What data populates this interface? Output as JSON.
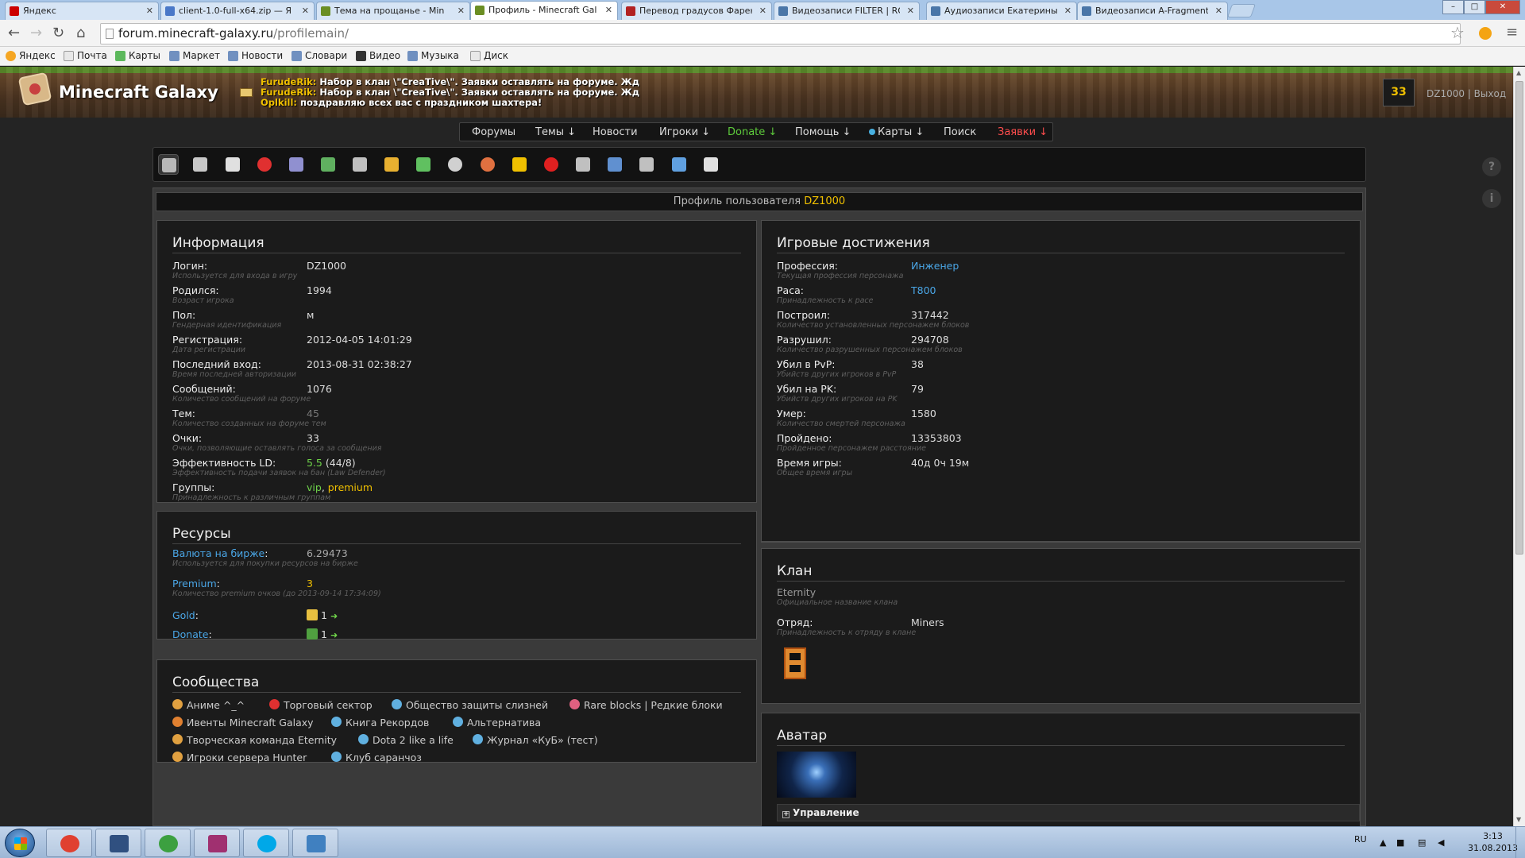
{
  "browser": {
    "tabs": [
      {
        "label": "Яндекс",
        "color": "#cc0000"
      },
      {
        "label": "client-1.0-full-x64.zip — Я",
        "color": "#4a78c8"
      },
      {
        "label": "Тема на прощанье - Min",
        "color": "#6b8e23"
      },
      {
        "label": "Профиль - Minecraft Gal",
        "color": "#6b8e23"
      },
      {
        "label": "Перевод градусов Фарен",
        "color": "#b22222"
      },
      {
        "label": "Видеозаписи FILTER | RO",
        "color": "#4a76a8"
      },
      {
        "label": "Аудиозаписи Екатерины",
        "color": "#4a76a8"
      },
      {
        "label": "Видеозаписи A-Fragment",
        "color": "#4a76a8"
      }
    ],
    "url_host": "forum.minecraft-galaxy.ru",
    "url_path": "/profilemain/",
    "window_min": "–",
    "window_max": "□",
    "window_close": "✕",
    "bookmarks": [
      {
        "label": "Яндекс",
        "icon": "yandex-icon",
        "color": "#f5a623"
      },
      {
        "label": "Почта",
        "icon": "page-icon",
        "color": "#e8e8e8"
      },
      {
        "label": "Карты",
        "icon": "maps-icon",
        "color": "#5cb85c"
      },
      {
        "label": "Маркет",
        "icon": "market-icon",
        "color": "#7090c0"
      },
      {
        "label": "Новости",
        "icon": "news-icon",
        "color": "#7090c0"
      },
      {
        "label": "Словари",
        "icon": "dict-icon",
        "color": "#7090c0"
      },
      {
        "label": "Видео",
        "icon": "video-icon",
        "color": "#333333"
      },
      {
        "label": "Музыка",
        "icon": "music-icon",
        "color": "#7090c0"
      },
      {
        "label": "Диск",
        "icon": "page-icon",
        "color": "#e8e8e8"
      }
    ]
  },
  "site": {
    "logo": "Minecraft Galaxy",
    "news": [
      {
        "who": "FurudeRik:",
        "text": " Набор в клан \\\"CreaTive\\\". Заявки оставлять на форуме. Жд"
      },
      {
        "who": "FurudeRik:",
        "text": " Набор в клан \\\"CreaTive\\\". Заявки оставлять на форуме. Жд"
      },
      {
        "who": "Oplkill:",
        "text": " поздравляю всех вас с праздником шахтера!"
      }
    ],
    "user_badge": "33",
    "user_name": "DZ1000",
    "user_sep": " | ",
    "logout": "Выход",
    "menu": [
      {
        "label": "Форумы",
        "style": ""
      },
      {
        "label": "Темы ↓",
        "style": ""
      },
      {
        "label": "Новости",
        "style": ""
      },
      {
        "label": "Игроки ↓",
        "style": ""
      },
      {
        "label": "Donate ↓",
        "style": "green"
      },
      {
        "label": "Помощь ↓",
        "style": ""
      },
      {
        "label": "Карты ↓",
        "style": "dot"
      },
      {
        "label": "Поиск",
        "style": ""
      },
      {
        "label": "Заявки ↓",
        "style": "red"
      }
    ],
    "icon_bar": [
      {
        "name": "profile-icon",
        "color": "#b8b8b8"
      },
      {
        "name": "lock-icon",
        "color": "#c8c8c8"
      },
      {
        "name": "home-icon",
        "color": "#e0e0e0"
      },
      {
        "name": "ban-icon",
        "color": "#e03030"
      },
      {
        "name": "window-icon",
        "color": "#9090d0"
      },
      {
        "name": "screenshot-icon",
        "color": "#60b060"
      },
      {
        "name": "cart-icon",
        "color": "#c0c0c0"
      },
      {
        "name": "medal-icon",
        "color": "#e8b030"
      },
      {
        "name": "user-icon",
        "color": "#60c060"
      },
      {
        "name": "gear-icon",
        "color": "#d0d0d0"
      },
      {
        "name": "alarm-icon",
        "color": "#e07040"
      },
      {
        "name": "star-icon",
        "color": "#f0c000"
      },
      {
        "name": "heart-icon",
        "color": "#e02020"
      },
      {
        "name": "chart-icon",
        "color": "#c0c0c0"
      },
      {
        "name": "mail-icon",
        "color": "#6090d0"
      },
      {
        "name": "notes-icon",
        "color": "#c0c0c0"
      },
      {
        "name": "folder-icon",
        "color": "#60a0e0"
      },
      {
        "name": "document-icon",
        "color": "#e0e0e0"
      }
    ],
    "side_help": "?",
    "side_info": "i"
  },
  "profile": {
    "title_prefix": "Профиль пользователя",
    "nick": "DZ1000",
    "info": {
      "heading": "Информация",
      "rows": [
        {
          "label": "Логин:",
          "sub": "Используется для входа в игру",
          "value": "DZ1000"
        },
        {
          "label": "Родился:",
          "sub": "Возраст игрока",
          "value": "1994"
        },
        {
          "label": "Пол:",
          "sub": "Гендерная идентификация",
          "value": "м"
        },
        {
          "label": "Регистрация:",
          "sub": "Дата регистрации",
          "value": "2012-04-05 14:01:29"
        },
        {
          "label": "Последний вход:",
          "sub": "Время последней авторизации",
          "value": "2013-08-31 02:38:27"
        },
        {
          "label": "Сообщений:",
          "sub": "Количество сообщений на форуме",
          "value": "1076"
        },
        {
          "label": "Тем:",
          "sub": "Количество созданных на форуме тем",
          "value": "45"
        },
        {
          "label": "Очки:",
          "sub": "Очки, позволяющие оставлять голоса за сообщения",
          "value": "33"
        },
        {
          "label": "Эффективность LD:",
          "sub": "Эффективность подачи заявок на бан (Law Defender)",
          "value_a": "5.5",
          "value_b": " (44/8)"
        },
        {
          "label": "Группы:",
          "sub": "Принадлежность к различным группам",
          "value_a": "vip",
          "value_sep": ", ",
          "value_b": "premium"
        }
      ]
    },
    "resources": {
      "heading": "Ресурсы",
      "rows": [
        {
          "label": "Валюта на бирже",
          "colon": ":",
          "sub": "Используется для покупки ресурсов на бирже",
          "value": "6.29473"
        },
        {
          "label": "Premium",
          "colon": ":",
          "sub": "Количество premium очков (до 2013-09-14 17:34:09)",
          "value": "3"
        },
        {
          "label": "Gold",
          "colon": ":",
          "value": "1",
          "arrow": "➜"
        },
        {
          "label": "Donate",
          "colon": ":",
          "value": "1",
          "arrow": "➜"
        }
      ]
    },
    "communities": {
      "heading": "Сообщества",
      "items": [
        {
          "label": "Аниме ^_^",
          "color": "#e0a040"
        },
        {
          "label": "Торговый сектор",
          "color": "#e03030"
        },
        {
          "label": "Общество защиты слизней",
          "color": "#60b0e0"
        },
        {
          "label": "Rare blocks | Редкие блоки",
          "color": "#e06080"
        },
        {
          "label": "Ивенты Minecraft Galaxy",
          "color": "#e08030"
        },
        {
          "label": "Книга Рекордов",
          "color": "#60b0e0"
        },
        {
          "label": "Альтернатива",
          "color": "#60b0e0"
        },
        {
          "label": "Творческая команда Eternity",
          "color": "#e0a040"
        },
        {
          "label": "Dota 2 like a life",
          "color": "#60b0e0"
        },
        {
          "label": "Журнал «КуБ» (тест)",
          "color": "#60b0e0"
        },
        {
          "label": "Игроки сервера Hunter",
          "color": "#e0a040"
        },
        {
          "label": "Клуб саранчоз",
          "color": "#60b0e0"
        }
      ]
    },
    "achievements": {
      "heading": "Игровые достижения",
      "rows": [
        {
          "label": "Профессия:",
          "sub": "Текущая профессия персонажа",
          "value": "Инженер",
          "style": "blue"
        },
        {
          "label": "Раса:",
          "sub": "Принадлежность к расе",
          "value": "T800",
          "style": "blue"
        },
        {
          "label": "Построил:",
          "sub": "Количество установленных персонажем блоков",
          "value": "317442",
          "style": ""
        },
        {
          "label": "Разрушил:",
          "sub": "Количество разрушенных персонажем блоков",
          "value": "294708",
          "style": ""
        },
        {
          "label": "Убил в PvP:",
          "sub": "Убийств других игроков в PvP",
          "value": "38",
          "style": ""
        },
        {
          "label": "Убил на PK:",
          "sub": "Убийств других игроков на PK",
          "value": "79",
          "style": ""
        },
        {
          "label": "Умер:",
          "sub": "Количество смертей персонажа",
          "value": "1580",
          "style": ""
        },
        {
          "label": "Пройдено:",
          "sub": "Пройденное персонажем расстояние",
          "value": "13353803",
          "style": ""
        },
        {
          "label": "Время игры:",
          "sub": "Общее время игры",
          "value": "40д 0ч 19м",
          "style": ""
        }
      ]
    },
    "clan": {
      "heading": "Клан",
      "name": "Eternity",
      "name_sub": "Официальное название клана",
      "squad_label": "Отряд:",
      "squad_sub": "Принадлежность к отряду в клане",
      "squad_value": "Miners"
    },
    "avatar": {
      "heading": "Аватар",
      "manage": "Управление",
      "manage_icon": "+"
    }
  },
  "taskbar": {
    "apps": [
      {
        "name": "chrome-icon",
        "color": "#e04030"
      },
      {
        "name": "devcpp-icon",
        "color": "#305080"
      },
      {
        "name": "utorrent-icon",
        "color": "#3ca040"
      },
      {
        "name": "winrar-icon",
        "color": "#a03070"
      },
      {
        "name": "skype-icon",
        "color": "#00a8e8"
      },
      {
        "name": "photo-viewer-icon",
        "color": "#4080c0"
      }
    ],
    "lang": "RU",
    "time": "3:13",
    "date": "31.08.2013"
  }
}
